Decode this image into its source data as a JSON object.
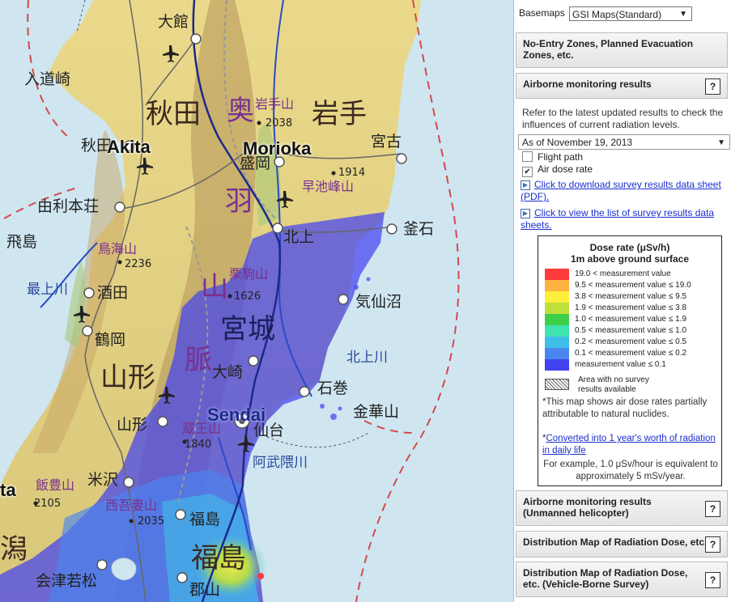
{
  "basemaps": {
    "label": "Basemaps",
    "selected": "GSI Maps(Standard)"
  },
  "sections": {
    "no_entry": "No-Entry Zones, Planned Evacuation Zones, etc.",
    "airborne": "Airborne monitoring results",
    "airborne_heli": "Airborne monitoring results (Unmanned helicopter)",
    "distribution": "Distribution Map of Radiation Dose, etc.",
    "vehicle": "Distribution Map of Radiation Dose, etc. (Vehicle-Borne Survey)"
  },
  "help_label": "?",
  "airborne_panel": {
    "description": "Refer to the latest updated results to check the influences of current radiation levels.",
    "date_selected": "As of November 19, 2013",
    "flight_path_label": "Flight path",
    "flight_path_checked": false,
    "air_dose_label": "Air dose rate",
    "air_dose_checked": true,
    "link_pdf": "Click to download survey results data sheet (PDF).",
    "link_list": "Click to view the list of survey results data sheets."
  },
  "legend": {
    "title1": "Dose rate (μSv/h)",
    "title2": "1m above ground surface",
    "rows": [
      {
        "label": "19.0 < measurement value",
        "color": "#ff3b3b"
      },
      {
        "label": "9.5 < measurement value ≤ 19.0",
        "color": "#ffb23f"
      },
      {
        "label": "3.8 < measurement value ≤  9.5",
        "color": "#ffef3c"
      },
      {
        "label": "1.9 < measurement value ≤  3.8",
        "color": "#bfe03a"
      },
      {
        "label": "1.0 < measurement value ≤  1.9",
        "color": "#3ecf4a"
      },
      {
        "label": "0.5 < measurement value ≤  1.0",
        "color": "#3fe3b0"
      },
      {
        "label": "0.2 < measurement value ≤  0.5",
        "color": "#3fbfe8"
      },
      {
        "label": "0.1 < measurement value ≤  0.2",
        "color": "#4a86f0"
      },
      {
        "label": "measurement value ≤  0.1",
        "color": "#4242f0"
      }
    ],
    "no_survey": "Area with no survey results available"
  },
  "notes": {
    "natural": "*This map shows air dose rates partially attributable to natural nuclides.",
    "converted_star": "*",
    "converted_link": "Converted into 1 year's worth of radiation in daily life",
    "example": "For example, 1.0 μSv/hour is equivalent to approximately 5 mSv/year."
  },
  "map_labels": {
    "odate": "大館",
    "akita_pref": "秋田",
    "iwate_pref": "岩手",
    "iwatesan": "岩手山",
    "iwatesan_elev": "2038",
    "morioka_jp": "盛岡",
    "morioka_en": "Morioka",
    "akita_city": "秋田",
    "akita_en": "Akita",
    "nyudozaki": "入道崎",
    "miyako": "宮古",
    "hayachine_elev": "1914",
    "hayachine": "早池峰山",
    "yurihonjo": "由利本荘",
    "kamaishi": "釜石",
    "kitakami_city": "北上",
    "tobishima": "飛島",
    "chokai": "鳥海山",
    "chokai_elev": "2236",
    "mogami": "最上川",
    "sakata": "酒田",
    "kurikoma": "栗駒山",
    "kurikoma_elev": "1626",
    "kesennuma": "気仙沼",
    "tsuruoka": "鶴岡",
    "miyagi_pref": "宮城",
    "kitakami_river": "北上川",
    "yamagata_pref": "山形",
    "osaki": "大崎",
    "ishinomaki": "石巻",
    "kinkasan": "金華山",
    "sendai_en": "Sendai",
    "zao": "蔵王山",
    "zao_elev": "1840",
    "sendai_jp": "仙台",
    "yamagata_city": "山形",
    "abukuma": "阿武隈川",
    "iide": "飯豊山",
    "iide_elev": "2105",
    "yonezawa": "米沢",
    "nishiazuma": "西吾妻山",
    "nishiazuma_elev": "2035",
    "fukushima_city": "福島",
    "fukushima_pref": "福島",
    "aizu": "会津若松",
    "koriyama": "郡山",
    "ou1": "奥",
    "ou2": "羽",
    "ou3": "山",
    "ou4": "脈",
    "ta_en": "ta",
    "kata": "潟"
  }
}
